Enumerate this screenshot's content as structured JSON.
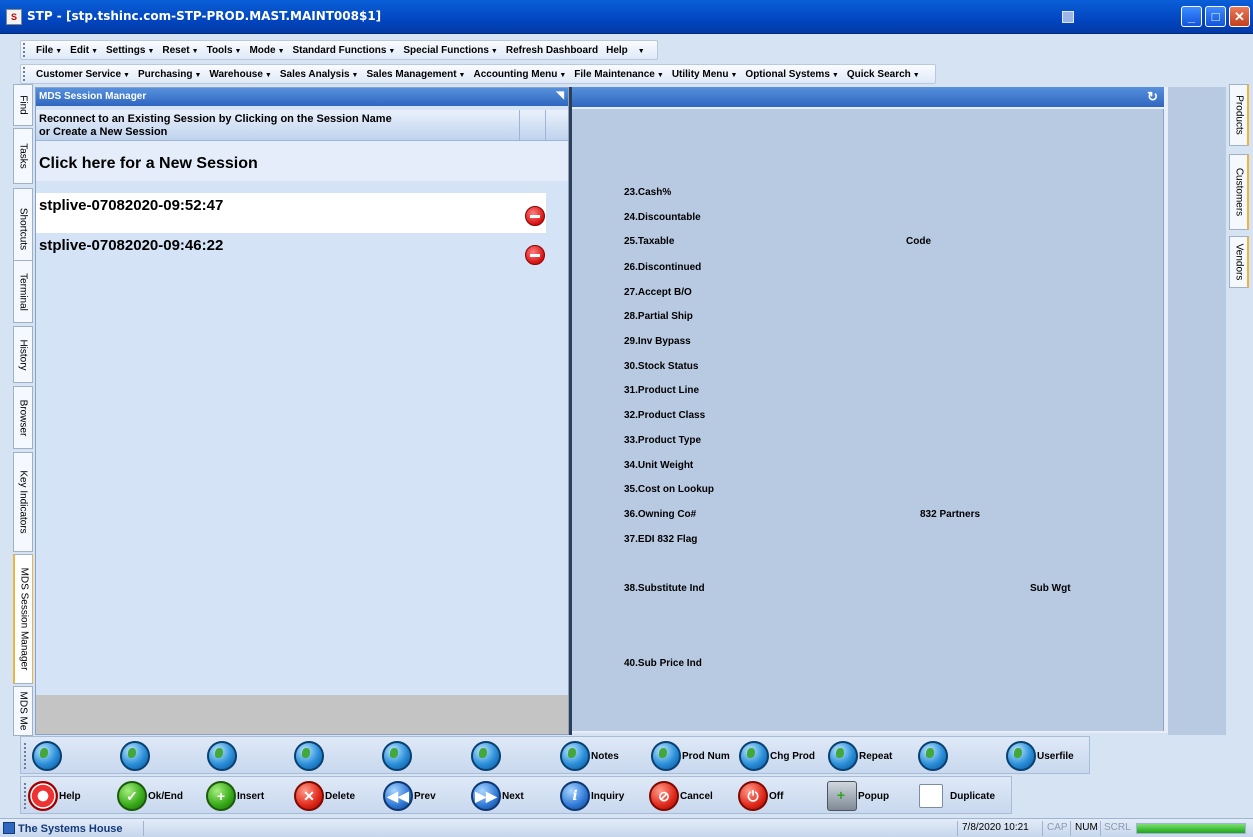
{
  "window": {
    "title": "STP - [stp.tshinc.com-STP-PROD.MAST.MAINT008$1]",
    "controls": [
      "_",
      "□",
      "✕"
    ]
  },
  "menu1": [
    "File",
    "Edit",
    "Settings",
    "Reset",
    "Tools",
    "Mode",
    "Standard Functions",
    "Special Functions",
    "Refresh Dashboard",
    "Help"
  ],
  "menu2": [
    "Customer Service",
    "Purchasing",
    "Warehouse",
    "Sales Analysis",
    "Sales Management",
    "Accounting Menu",
    "File Maintenance",
    "Utility Menu",
    "Optional Systems",
    "Quick Search"
  ],
  "left_tabs": [
    "Find",
    "Tasks",
    "Shortcuts",
    "Terminal",
    "History",
    "Browser",
    "Key Indicators",
    "MDS Session Manager",
    "MDS Me"
  ],
  "right_tabs": [
    "Products",
    "Customers",
    "Vendors"
  ],
  "session_manager": {
    "title": "MDS Session Manager",
    "prompt_line1": "Reconnect to an Existing Session by Clicking on the Session Name",
    "prompt_line2": "or Create a  New Session",
    "new_session": "Click here for a New Session",
    "sessions": [
      "stplive-07082020-09:52:47",
      "stplive-07082020-09:46:22"
    ]
  },
  "form": {
    "fields": [
      "23.Cash%",
      "24.Discountable",
      "25.Taxable",
      "26.Discontinued",
      "27.Accept B/O",
      "28.Partial Ship",
      "29.Inv Bypass",
      "30.Stock Status",
      "31.Product Line",
      "32.Product Class",
      "33.Product Type",
      "34.Unit Weight",
      "35.Cost on Lookup",
      "36.Owning Co#",
      "37.EDI 832 Flag",
      "38.Substitute Ind",
      "40.Sub Price Ind"
    ],
    "code_label": "Code",
    "partners_label": "832 Partners",
    "subwgt_label": "Sub Wgt"
  },
  "fkeys_top": {
    "notes": "Notes",
    "prod_num": "Prod Num",
    "chg_prod": "Chg Prod",
    "repeat": "Repeat",
    "userfile": "Userfile"
  },
  "fkeys_bottom": {
    "help": "Help",
    "ok_end": "Ok/End",
    "insert": "Insert",
    "delete": "Delete",
    "prev": "Prev",
    "next": "Next",
    "inquiry": "Inquiry",
    "cancel": "Cancel",
    "off": "Off",
    "popup": "Popup",
    "duplicate": "Duplicate"
  },
  "status": {
    "app": "The Systems House",
    "datetime": "7/8/2020 10:21",
    "cap": "CAP",
    "num": "NUM",
    "scrl": "SCRL",
    "progress": 1.0
  }
}
